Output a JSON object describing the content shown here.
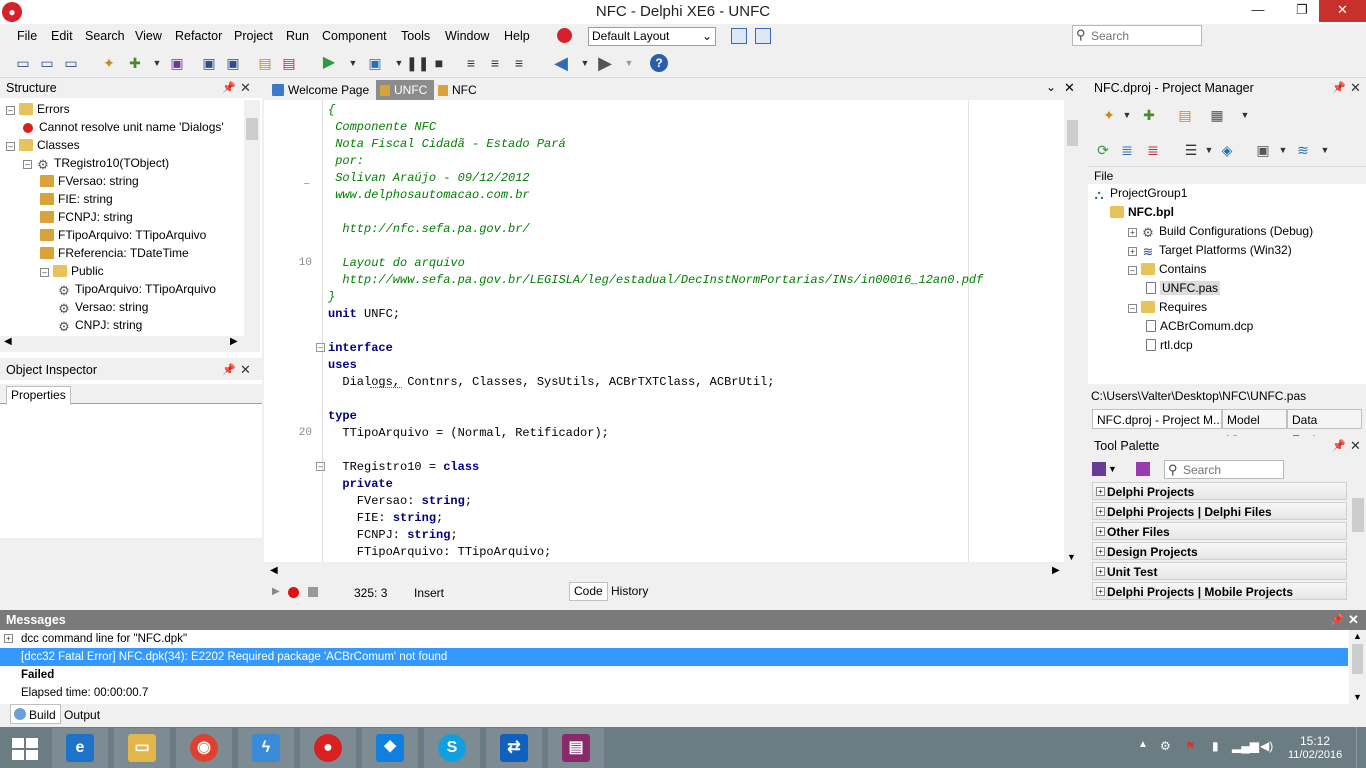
{
  "window": {
    "title": "NFC - Delphi XE6 - UNFC",
    "minimize": "—",
    "restore": "❐",
    "close": "✕"
  },
  "menu": [
    "File",
    "Edit",
    "Search",
    "View",
    "Refactor",
    "Project",
    "Run",
    "Component",
    "Tools",
    "Window",
    "Help"
  ],
  "layout_select": {
    "value": "Default Layout"
  },
  "search": {
    "placeholder": "Search"
  },
  "structure": {
    "title": "Structure",
    "rows": [
      {
        "label": "Errors",
        "indent": 0,
        "icon": "errors-folder-icon"
      },
      {
        "label": "Cannot resolve unit name 'Dialogs'",
        "indent": 1,
        "icon": "error-icon"
      },
      {
        "label": "Classes",
        "indent": 0,
        "icon": "folder-icon"
      },
      {
        "label": "TRegistro10(TObject)",
        "indent": 1,
        "icon": "class-icon"
      },
      {
        "label": "FVersao: string",
        "indent": 2,
        "icon": "field-icon"
      },
      {
        "label": "FIE: string",
        "indent": 2,
        "icon": "field-icon"
      },
      {
        "label": "FCNPJ: string",
        "indent": 2,
        "icon": "field-icon"
      },
      {
        "label": "FTipoArquivo: TTipoArquivo",
        "indent": 2,
        "icon": "field-icon"
      },
      {
        "label": "FReferencia: TDateTime",
        "indent": 2,
        "icon": "field-icon"
      },
      {
        "label": "Public",
        "indent": 2,
        "icon": "folder-icon"
      },
      {
        "label": "TipoArquivo: TTipoArquivo",
        "indent": 3,
        "icon": "property-icon"
      },
      {
        "label": "Versao: string",
        "indent": 3,
        "icon": "property-icon"
      },
      {
        "label": "CNPJ: string",
        "indent": 3,
        "icon": "property-icon"
      }
    ]
  },
  "object_inspector": {
    "title": "Object Inspector",
    "tab": "Properties"
  },
  "editor_tabs": [
    {
      "label": "Welcome Page",
      "active": false
    },
    {
      "label": "UNFC",
      "active": true
    },
    {
      "label": "NFC",
      "active": false
    }
  ],
  "code_lines": [
    {
      "segments": [
        {
          "t": "{",
          "c": "cm"
        }
      ]
    },
    {
      "segments": [
        {
          "t": " Componente NFC",
          "c": "cm"
        }
      ]
    },
    {
      "segments": [
        {
          "t": " Nota Fiscal Cidadã - Estado Pará",
          "c": "cm"
        }
      ]
    },
    {
      "segments": [
        {
          "t": " por:",
          "c": "cm"
        }
      ]
    },
    {
      "segments": [
        {
          "t": " Solivan Araújo - 09/12/2012",
          "c": "cm"
        }
      ]
    },
    {
      "segments": [
        {
          "t": " www.delphosautomacao.com.br",
          "c": "cm"
        }
      ]
    },
    {
      "segments": [
        {
          "t": "",
          "c": "cm"
        }
      ]
    },
    {
      "segments": [
        {
          "t": "  http://nfc.sefa.pa.gov.br/",
          "c": "cm"
        }
      ]
    },
    {
      "segments": [
        {
          "t": "",
          "c": "cm"
        }
      ]
    },
    {
      "segments": [
        {
          "t": "  Layout do arquivo",
          "c": "cm"
        }
      ]
    },
    {
      "segments": [
        {
          "t": "  http://www.sefa.pa.gov.br/LEGISLA/leg/estadual/DecInstNormPortarias/INs/in00016_12an0.pdf",
          "c": "cm"
        }
      ]
    },
    {
      "segments": [
        {
          "t": "}",
          "c": "cm"
        }
      ]
    },
    {
      "segments": [
        {
          "t": "unit",
          "c": "kw"
        },
        {
          "t": " UNFC;",
          "c": ""
        }
      ]
    },
    {
      "segments": [
        {
          "t": "",
          "c": ""
        }
      ]
    },
    {
      "segments": [
        {
          "t": "interface",
          "c": "kw"
        }
      ]
    },
    {
      "segments": [
        {
          "t": "uses",
          "c": "kw"
        }
      ]
    },
    {
      "segments": [
        {
          "t": "  Dialogs, Contnrs, Classes, SysUtils, ACBrTXTClass, ACBrUtil;",
          "c": ""
        }
      ]
    },
    {
      "segments": [
        {
          "t": "",
          "c": ""
        }
      ]
    },
    {
      "segments": [
        {
          "t": "type",
          "c": "kw"
        }
      ]
    },
    {
      "segments": [
        {
          "t": "  TTipoArquivo = (Normal, Retificador);",
          "c": ""
        }
      ]
    },
    {
      "segments": [
        {
          "t": "",
          "c": ""
        }
      ]
    },
    {
      "segments": [
        {
          "t": "  TRegistro10 = ",
          "c": ""
        },
        {
          "t": "class",
          "c": "kw"
        }
      ]
    },
    {
      "segments": [
        {
          "t": "  private",
          "c": "kw"
        }
      ]
    },
    {
      "segments": [
        {
          "t": "    FVersao: ",
          "c": ""
        },
        {
          "t": "string",
          "c": "kw"
        },
        {
          "t": ";",
          "c": ""
        }
      ]
    },
    {
      "segments": [
        {
          "t": "    FIE: ",
          "c": ""
        },
        {
          "t": "string",
          "c": "kw"
        },
        {
          "t": ";",
          "c": ""
        }
      ]
    },
    {
      "segments": [
        {
          "t": "    FCNPJ: ",
          "c": ""
        },
        {
          "t": "string",
          "c": "kw"
        },
        {
          "t": ";",
          "c": ""
        }
      ]
    },
    {
      "segments": [
        {
          "t": "    FTipoArquivo: TTipoArquivo;",
          "c": ""
        }
      ]
    }
  ],
  "line_numbers": [
    {
      "row": 9,
      "n": "10"
    },
    {
      "row": 19,
      "n": "20"
    }
  ],
  "statusbar": {
    "position": "325:  3",
    "mode": "Insert",
    "tab_code": "Code",
    "tab_history": "History"
  },
  "project_manager": {
    "title": "NFC.dproj - Project Manager",
    "column": "File",
    "rows": [
      {
        "label": "ProjectGroup1",
        "indent": 0,
        "bold": false
      },
      {
        "label": "NFC.bpl",
        "indent": 1,
        "bold": true
      },
      {
        "label": "Build Configurations (Debug)",
        "indent": 2,
        "bold": false
      },
      {
        "label": "Target Platforms (Win32)",
        "indent": 2,
        "bold": false
      },
      {
        "label": "Contains",
        "indent": 2,
        "bold": false
      },
      {
        "label": "UNFC.pas",
        "indent": 3,
        "bold": false
      },
      {
        "label": "Requires",
        "indent": 2,
        "bold": false
      },
      {
        "label": "ACBrComum.dcp",
        "indent": 3,
        "bold": false
      },
      {
        "label": "rtl.dcp",
        "indent": 3,
        "bold": false
      }
    ],
    "path": "C:\\Users\\Valter\\Desktop\\NFC\\UNFC.pas",
    "tabs": [
      "NFC.dproj - Project M...",
      "Model View",
      "Data Explorer"
    ]
  },
  "tool_palette": {
    "title": "Tool Palette",
    "search_placeholder": "Search",
    "categories": [
      "Delphi Projects",
      "Delphi Projects | Delphi Files",
      "Other Files",
      "Design Projects",
      "Unit Test",
      "Delphi Projects | Mobile Projects"
    ]
  },
  "messages": {
    "title": "Messages",
    "rows": [
      {
        "text": "dcc command line for \"NFC.dpk\"",
        "style": "normal"
      },
      {
        "text": "[dcc32 Fatal Error] NFC.dpk(34): E2202 Required package 'ACBrComum' not found",
        "style": "selected"
      },
      {
        "text": "Failed",
        "style": "bold"
      },
      {
        "text": "Elapsed time: 00:00:00.7",
        "style": "normal"
      }
    ],
    "tabs": [
      "Build",
      "Output"
    ]
  },
  "taskbar": {
    "apps": [
      "ie-icon",
      "file-explorer-icon",
      "chrome-icon",
      "app-bolt-icon",
      "delphi-icon",
      "dropbox-icon",
      "skype-icon",
      "teamviewer-icon",
      "winrar-icon"
    ],
    "time": "15:12",
    "date": "11/02/2016"
  },
  "colors": {
    "selection": "#3399ff",
    "comment": "#008000",
    "keyword": "#000080",
    "taskbar": "#6b7d83"
  }
}
